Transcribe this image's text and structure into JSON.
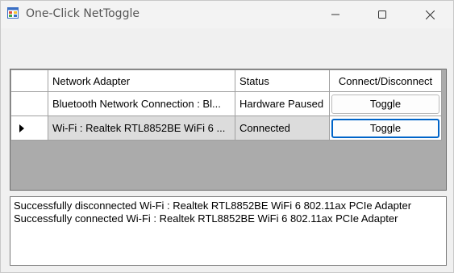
{
  "window": {
    "title": "One-Click NetToggle",
    "icon": "app-window-icon",
    "controls": [
      "minimize-icon",
      "maximize-icon",
      "close-icon"
    ]
  },
  "grid": {
    "columns": [
      "Network Adapter",
      "Status",
      "Connect/Disconnect"
    ],
    "rows": [
      {
        "adapter": "Bluetooth Network Connection : Bl...",
        "status": "Hardware Paused",
        "action": "Toggle",
        "selected": false
      },
      {
        "adapter": "Wi-Fi : Realtek RTL8852BE WiFi 6 ...",
        "status": "Connected",
        "action": "Toggle",
        "selected": true
      }
    ]
  },
  "log": {
    "lines": [
      "Successfully disconnected Wi-Fi : Realtek RTL8852BE WiFi 6 802.11ax PCIe Adapter",
      "Successfully connected Wi-Fi : Realtek RTL8852BE WiFi 6 802.11ax PCIe Adapter"
    ]
  },
  "colors": {
    "focus_border": "#0064c8",
    "grid_background": "#ababab",
    "selected_row": "#dcdcdc"
  }
}
